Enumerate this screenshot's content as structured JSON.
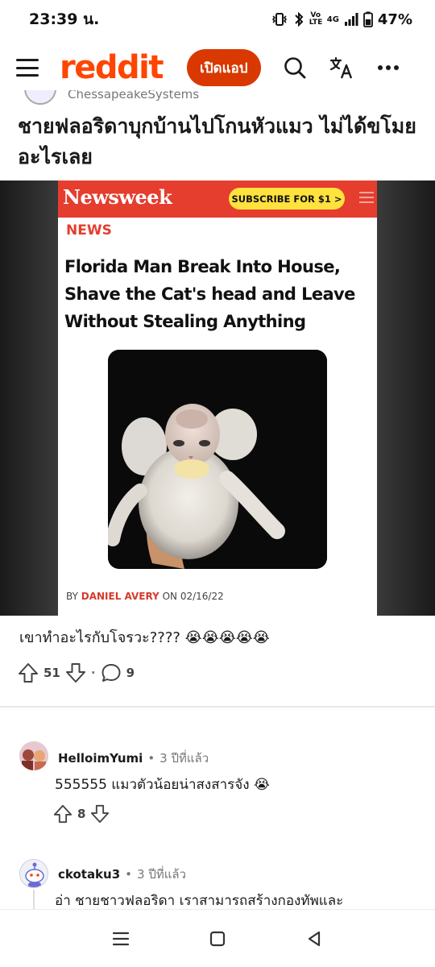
{
  "status_bar": {
    "time": "23:39 น.",
    "network": "4G",
    "volte": "Vo LTE",
    "battery": "47%"
  },
  "header": {
    "logo": "reddit",
    "open_app_label": "เปิดแอป",
    "icons": [
      "menu-icon",
      "search-icon",
      "translate-icon",
      "more-icon"
    ]
  },
  "post": {
    "subreddit": "ChessapeakeSystems",
    "title": "ชายฟลอริดาบุกบ้านไปโกนหัวแมว ไม่ได้ขโมยอะไรเลย",
    "body": "เขาทำอะไรกับโจรวะ???? 😭😭😭😭😭",
    "upvotes": "51",
    "comments": "9",
    "image": {
      "brand": "Newsweek",
      "subscribe": "SUBSCRIBE FOR $1 >",
      "section": "NEWS",
      "headline": "Florida Man Break Into House, Shave the Cat's head and Leave Without Stealing Anything",
      "byline_prefix": "BY",
      "byline_author": "DANIEL AVERY",
      "byline_date": "ON 02/16/22"
    }
  },
  "comments": [
    {
      "author": "HelloimYumi",
      "time": "3 ปีที่แล้ว",
      "text": "555555 แมวตัวน้อยน่าสงสารจัง 😭",
      "upvotes": "8"
    },
    {
      "author": "ckotaku3",
      "time": "3 ปีที่แล้ว",
      "text": "อ่า ชายชาวฟลอริดา เราสามารถสร้างกองทัพและ"
    }
  ],
  "nav": [
    "recent-apps-icon",
    "home-icon",
    "back-icon"
  ]
}
